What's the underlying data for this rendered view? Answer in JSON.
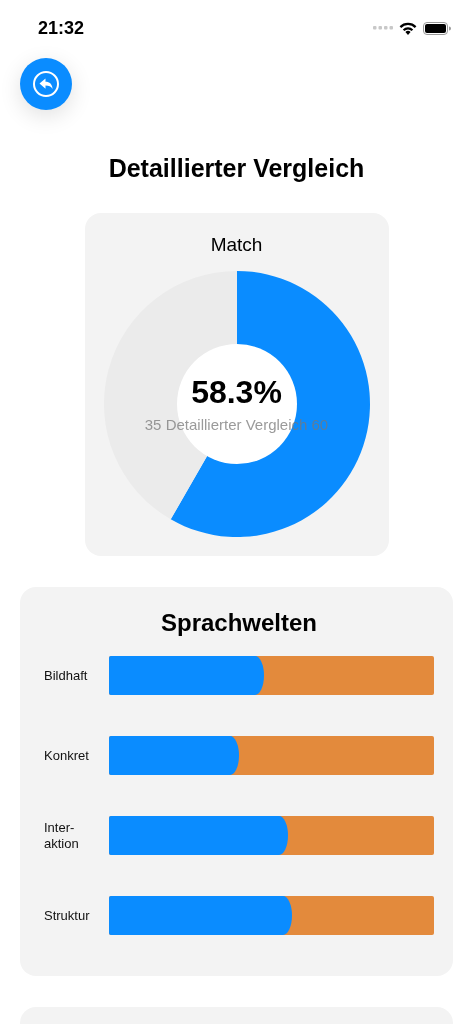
{
  "status_bar": {
    "time": "21:32"
  },
  "title": "Detaillierter Vergleich",
  "match": {
    "title": "Match",
    "value": "58.3%",
    "caption": "35 Detaillierter Vergleich 60",
    "chart_data": {
      "type": "donut",
      "values": [
        58.3,
        41.7
      ]
    }
  },
  "sprachwelten": {
    "title": "Sprachwelten",
    "rows": [
      {
        "label": "Bildhaft",
        "level": 0.477
      },
      {
        "label": "Konkret",
        "level": 0.4
      },
      {
        "label": "Inter-aktion",
        "level": 0.551
      },
      {
        "label": "Struktur",
        "level": 0.563
      }
    ]
  }
}
